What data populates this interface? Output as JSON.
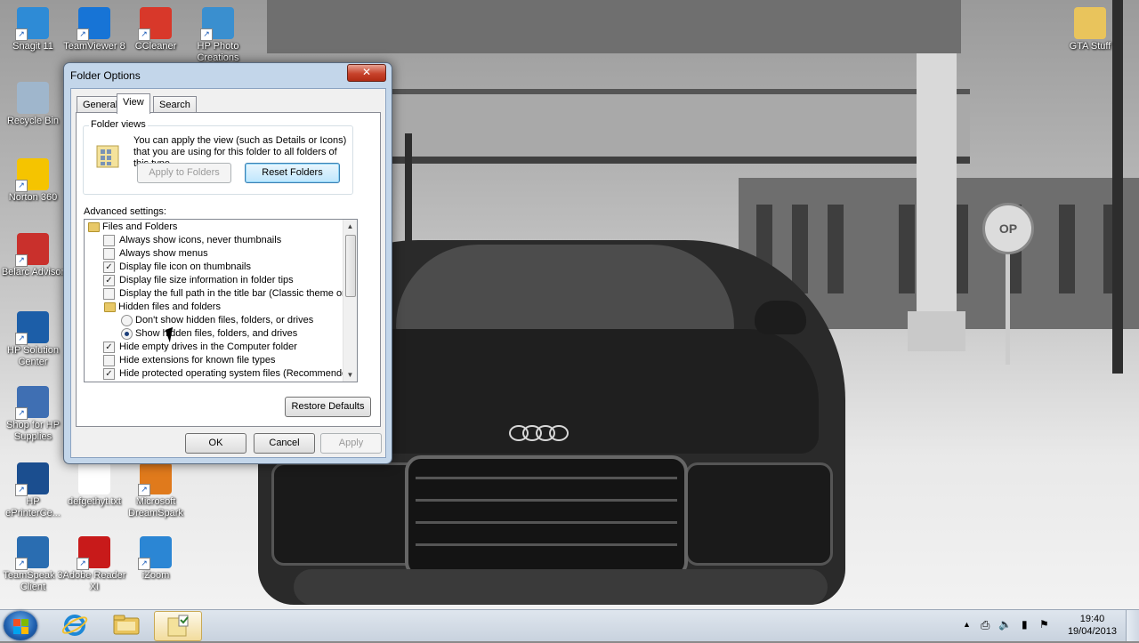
{
  "desktop": {
    "icons": [
      {
        "label": "Snagit 11",
        "icon": "snagit-icon",
        "color": "#2e8bd6"
      },
      {
        "label": "TeamViewer 8",
        "icon": "teamviewer-icon",
        "color": "#1774d6"
      },
      {
        "label": "CCleaner",
        "icon": "ccleaner-icon",
        "color": "#d8382a"
      },
      {
        "label": "HP Photo Creations",
        "icon": "hp-photo-creations-icon",
        "color": "#3a8fcf"
      },
      {
        "label": "GTA Stuff",
        "icon": "folder-icon",
        "color": "#e9c45c"
      },
      {
        "label": "Recycle Bin",
        "icon": "recycle-bin-icon",
        "color": "#9fb6cc"
      },
      {
        "label": "Norton 360",
        "icon": "norton-icon",
        "color": "#f5c400"
      },
      {
        "label": "Belarc Advisor",
        "icon": "belarc-icon",
        "color": "#c9302c"
      },
      {
        "label": "HP Solution Center",
        "icon": "hp-solution-center-icon",
        "color": "#1c5ea8"
      },
      {
        "label": "Shop for HP Supplies",
        "icon": "hp-supplies-icon",
        "color": "#3f6fb3"
      },
      {
        "label": "HP ePrinterCe...",
        "icon": "hp-eprint-icon",
        "color": "#1b4e8f"
      },
      {
        "label": "defgethyt.txt",
        "icon": "text-file-icon",
        "color": "#ffffff"
      },
      {
        "label": "Microsoft DreamSpark",
        "icon": "dreamspark-icon",
        "color": "#e07a1c"
      },
      {
        "label": "TeamSpeak 3 Client",
        "icon": "teamspeak-icon",
        "color": "#2a6db1"
      },
      {
        "label": "Adobe Reader XI",
        "icon": "adobe-reader-icon",
        "color": "#c81a1a"
      },
      {
        "label": "iZoom",
        "icon": "izoom-icon",
        "color": "#2b86d4"
      }
    ]
  },
  "dialog": {
    "title": "Folder Options",
    "close_glyph": "✕",
    "tabs": [
      "General",
      "View",
      "Search"
    ],
    "active_tab": "View",
    "folder_views": {
      "legend": "Folder views",
      "description": "You can apply the view (such as Details or Icons) that you are using for this folder to all folders of this type.",
      "apply_button": "Apply to Folders",
      "reset_button": "Reset Folders"
    },
    "advanced_label": "Advanced settings:",
    "settings": [
      {
        "type": "folder",
        "label": "Files and Folders"
      },
      {
        "type": "checkbox",
        "label": "Always show icons, never thumbnails",
        "checked": false
      },
      {
        "type": "checkbox",
        "label": "Always show menus",
        "checked": false
      },
      {
        "type": "checkbox",
        "label": "Display file icon on thumbnails",
        "checked": true
      },
      {
        "type": "checkbox",
        "label": "Display file size information in folder tips",
        "checked": true
      },
      {
        "type": "checkbox",
        "label": "Display the full path in the title bar (Classic theme only)",
        "checked": false
      },
      {
        "type": "subfolder",
        "label": "Hidden files and folders"
      },
      {
        "type": "radio",
        "label": "Don't show hidden files, folders, or drives",
        "checked": false
      },
      {
        "type": "radio",
        "label": "Show hidden files, folders, and drives",
        "checked": true
      },
      {
        "type": "checkbox",
        "label": "Hide empty drives in the Computer folder",
        "checked": true
      },
      {
        "type": "checkbox",
        "label": "Hide extensions for known file types",
        "checked": false
      },
      {
        "type": "checkbox",
        "label": "Hide protected operating system files (Recommended)",
        "checked": true
      }
    ],
    "scroll_up": "▲",
    "scroll_down": "▼",
    "restore_defaults": "Restore Defaults",
    "ok": "OK",
    "cancel": "Cancel",
    "apply": "Apply"
  },
  "taskbar": {
    "pinned": [
      "internet-explorer-icon",
      "file-explorer-icon",
      "folder-options-icon"
    ],
    "tray_icons": [
      "show-hidden-icons-chevron",
      "network-device-icon",
      "volume-icon",
      "signal-icon",
      "action-center-flag-icon"
    ],
    "tray_glyphs": [
      "▲",
      "⎙",
      "🔈",
      "▮",
      "⚑"
    ],
    "time": "19:40",
    "date": "19/04/2013"
  }
}
